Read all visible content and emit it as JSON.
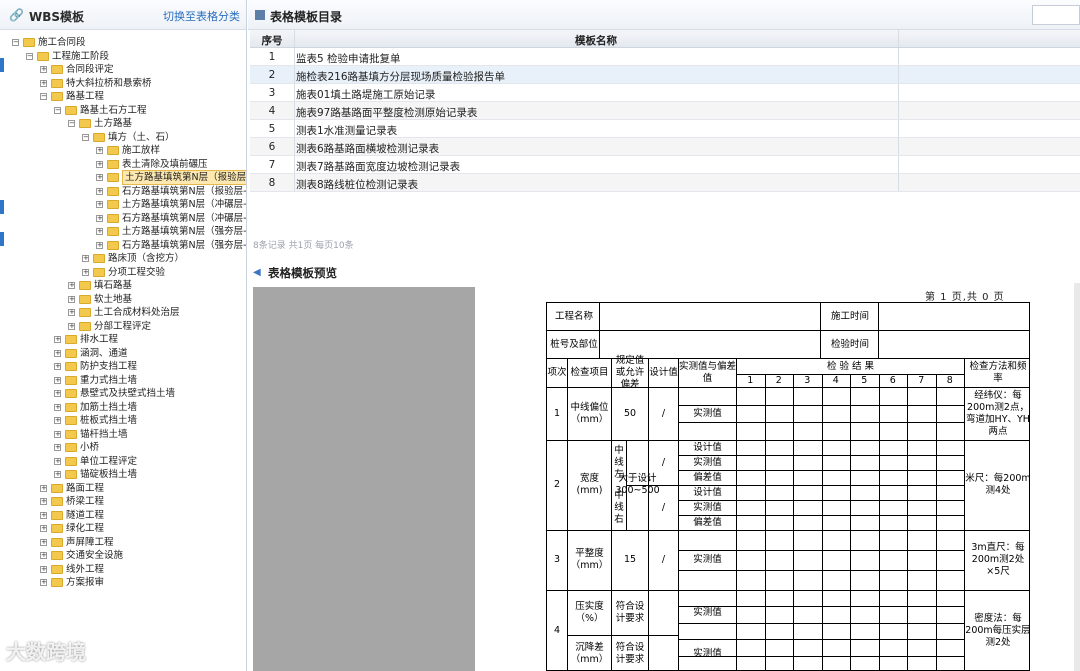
{
  "left_panel": {
    "title": "WBS模板",
    "switch_label": "切换至表格分类"
  },
  "tree": [
    {
      "label": "施工合同段",
      "depth": 0,
      "toggle": "−"
    },
    {
      "label": "工程施工阶段",
      "depth": 1,
      "toggle": "−"
    },
    {
      "label": "合同段评定",
      "depth": 2,
      "toggle": "+"
    },
    {
      "label": "特大斜拉桥和悬索桥",
      "depth": 2,
      "toggle": "+"
    },
    {
      "label": "路基工程",
      "depth": 2,
      "toggle": "−"
    },
    {
      "label": "路基土石方工程",
      "depth": 3,
      "toggle": "−"
    },
    {
      "label": "土方路基",
      "depth": 4,
      "toggle": "−"
    },
    {
      "label": "填方（土、石）",
      "depth": 5,
      "toggle": "−"
    },
    {
      "label": "施工放样",
      "depth": 6,
      "toggle": "+"
    },
    {
      "label": "表土清除及填前碾压",
      "depth": 6,
      "toggle": "+"
    },
    {
      "label": "土方路基填筑第N层（报验层-压",
      "depth": 6,
      "toggle": "+",
      "selected": true
    },
    {
      "label": "石方路基填筑第N层（报验层-沉",
      "depth": 6,
      "toggle": "+"
    },
    {
      "label": "土方路基填筑第N层（冲碾层-压",
      "depth": 6,
      "toggle": "+"
    },
    {
      "label": "石方路基填筑第N层（冲碾层-沉",
      "depth": 6,
      "toggle": "+"
    },
    {
      "label": "土方路基填筑第N层（强夯层-压",
      "depth": 6,
      "toggle": "+"
    },
    {
      "label": "石方路基填筑第N层（强夯层-沉",
      "depth": 6,
      "toggle": "+"
    },
    {
      "label": "路床顶（含挖方）",
      "depth": 5,
      "toggle": "+"
    },
    {
      "label": "分项工程交验",
      "depth": 5,
      "toggle": "+"
    },
    {
      "label": "填石路基",
      "depth": 4,
      "toggle": "+"
    },
    {
      "label": "软土地基",
      "depth": 4,
      "toggle": "+"
    },
    {
      "label": "土工合成材料处治层",
      "depth": 4,
      "toggle": "+"
    },
    {
      "label": "分部工程评定",
      "depth": 4,
      "toggle": "+"
    },
    {
      "label": "排水工程",
      "depth": 3,
      "toggle": "+"
    },
    {
      "label": "涵洞、通道",
      "depth": 3,
      "toggle": "+"
    },
    {
      "label": "防护支挡工程",
      "depth": 3,
      "toggle": "+"
    },
    {
      "label": "重力式挡土墙",
      "depth": 3,
      "toggle": "+"
    },
    {
      "label": "悬壁式及扶壁式挡土墙",
      "depth": 3,
      "toggle": "+"
    },
    {
      "label": "加筋土挡土墙",
      "depth": 3,
      "toggle": "+"
    },
    {
      "label": "桩板式挡土墙",
      "depth": 3,
      "toggle": "+"
    },
    {
      "label": "锚杆挡土墙",
      "depth": 3,
      "toggle": "+"
    },
    {
      "label": "小桥",
      "depth": 3,
      "toggle": "+"
    },
    {
      "label": "单位工程评定",
      "depth": 3,
      "toggle": "+"
    },
    {
      "label": "锚碇板挡土墙",
      "depth": 3,
      "toggle": "+"
    },
    {
      "label": "路面工程",
      "depth": 2,
      "toggle": "+"
    },
    {
      "label": "桥梁工程",
      "depth": 2,
      "toggle": "+"
    },
    {
      "label": "隧道工程",
      "depth": 2,
      "toggle": "+"
    },
    {
      "label": "绿化工程",
      "depth": 2,
      "toggle": "+"
    },
    {
      "label": "声屏障工程",
      "depth": 2,
      "toggle": "+"
    },
    {
      "label": "交通安全设施",
      "depth": 2,
      "toggle": "+"
    },
    {
      "label": "线外工程",
      "depth": 2,
      "toggle": "+"
    },
    {
      "label": "方案报审",
      "depth": 2,
      "toggle": "+"
    }
  ],
  "catalog": {
    "title": "表格模板目录",
    "col_no": "序号",
    "col_name": "模板名称",
    "rows": [
      {
        "no": "1",
        "name": "监表5 检验申请批复单"
      },
      {
        "no": "2",
        "name": "施检表216路基填方分层现场质量检验报告单"
      },
      {
        "no": "3",
        "name": "施表01填土路堤施工原始记录"
      },
      {
        "no": "4",
        "name": "施表97路基路面平整度检测原始记录表"
      },
      {
        "no": "5",
        "name": "测表1水准测量记录表"
      },
      {
        "no": "6",
        "name": "测表6路基路面横坡检测记录表"
      },
      {
        "no": "7",
        "name": "测表7路基路面宽度边坡检测记录表"
      },
      {
        "no": "8",
        "name": "测表8路线桩位检测记录表"
      }
    ],
    "pager": "8条记录  共1页 每页10条"
  },
  "preview": {
    "title": "表格模板预览",
    "page_text": "第  1  页,共  0  页",
    "form": {
      "project_name": "工程名称",
      "construction_time": "施工时间",
      "station": "桩号及部位",
      "inspection_time": "检验时间",
      "h_item_no": "项次",
      "h_item": "检查项目",
      "h_spec": "规定值或允许偏差",
      "h_design": "设计值",
      "h_measured": "实测值与偏差值",
      "h_result": "检  验  结  果",
      "h_method": "检查方法和频率",
      "cols": [
        "1",
        "2",
        "3",
        "4",
        "5",
        "6",
        "7",
        "8"
      ],
      "r1_no": "1",
      "r1_item": "中线偏位（mm）",
      "r1_spec": "50",
      "r1_design": "/",
      "r1_val": "实测值",
      "r1_method": "经纬仪：每200m测2点，弯道加HY、YH两点",
      "r2_no": "2",
      "r2_item": "宽度(mm)",
      "r2_left": "中线左",
      "r2_right": "中线右",
      "r2_spec": "大于设计300~500",
      "r2_design1": "/",
      "r2_design2": "/",
      "r2_v1": "设计值",
      "r2_v2": "实测值",
      "r2_v3": "偏差值",
      "r2_v4": "设计值",
      "r2_v5": "实测值",
      "r2_v6": "偏差值",
      "r2_method": "米尺：每200m测4处",
      "r3_no": "3",
      "r3_item": "平整度（mm）",
      "r3_spec": "15",
      "r3_design": "/",
      "r3_val": "实测值",
      "r3_method": "3m直尺：每200m测2处×5尺",
      "r4_no": "4",
      "r4a_item": "压实度（%）",
      "r4a_spec": "符合设计要求",
      "r4a_val": "实测值",
      "r4b_item": "沉降差（mm）",
      "r4b_spec": "符合设计要求",
      "r4b_val": "实测值",
      "r4_method": "密度法：每200m每压实层测2处"
    }
  },
  "watermark": "大数跨境",
  "colors": {
    "accent": "#2f76c9",
    "folder": "#f2c94c",
    "selected": "#fde8b0"
  }
}
